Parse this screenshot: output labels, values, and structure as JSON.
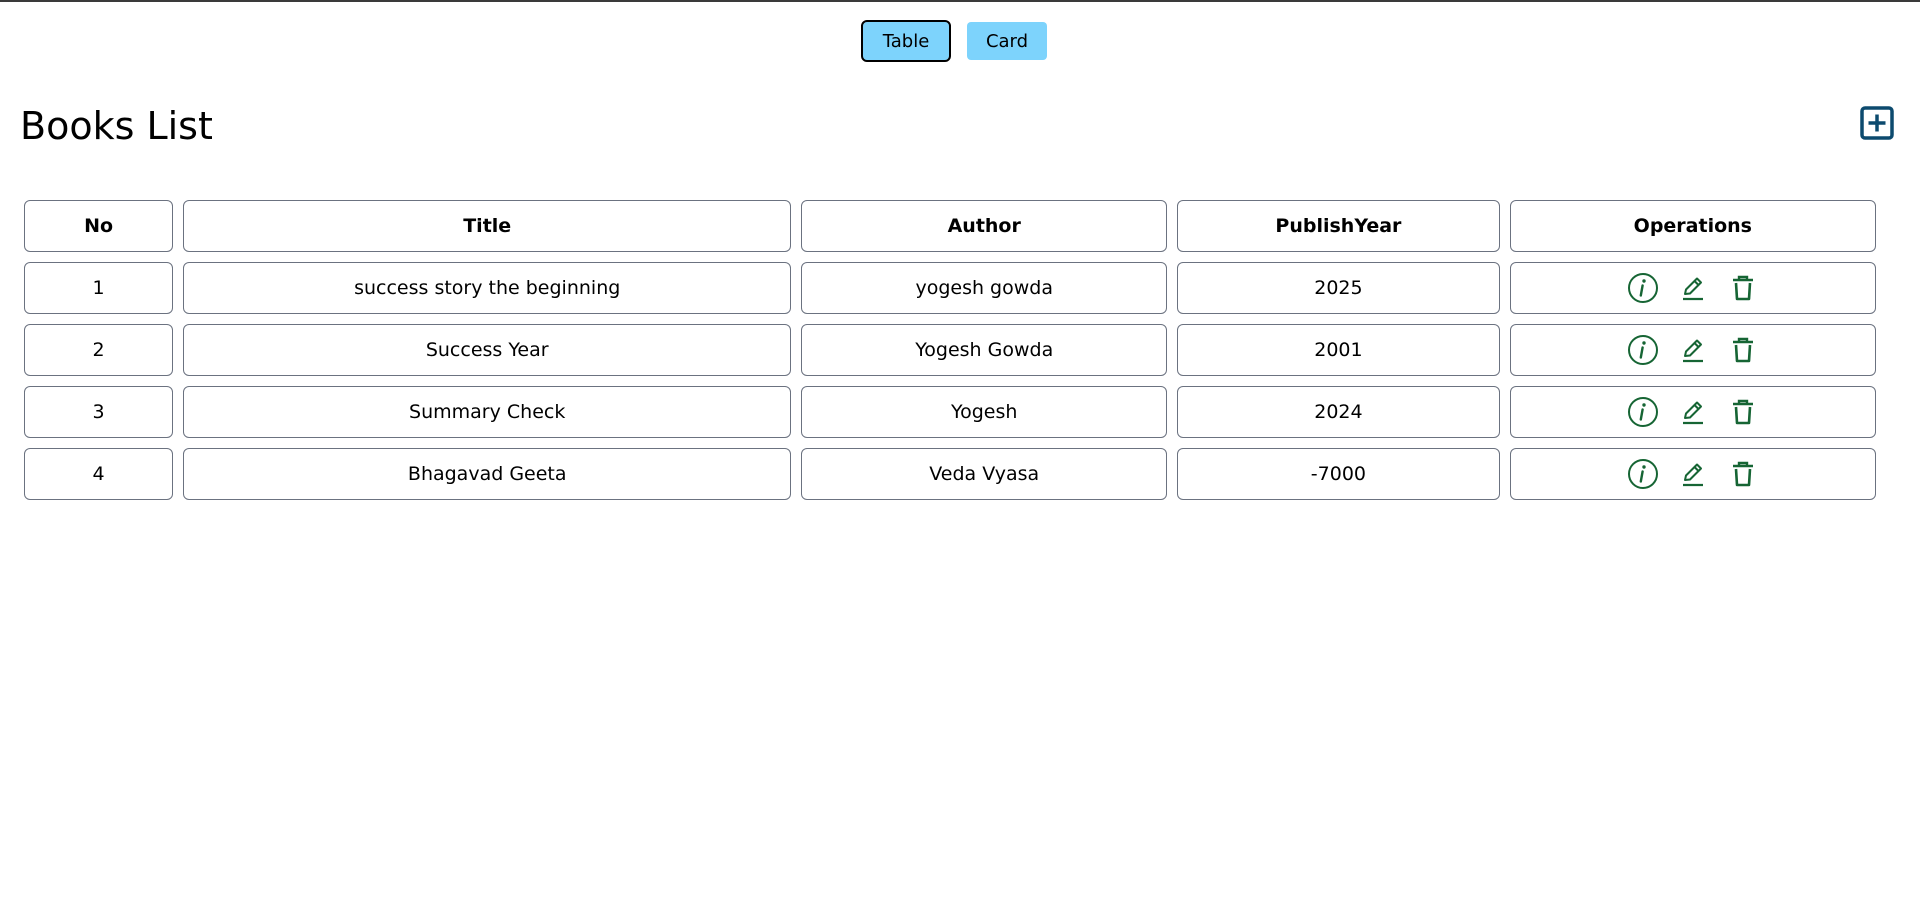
{
  "view_toggle": {
    "table_label": "Table",
    "card_label": "Card",
    "active": "Table"
  },
  "page": {
    "title": "Books List",
    "add_icon": "plus-square-icon"
  },
  "table": {
    "headers": [
      "No",
      "Title",
      "Author",
      "PublishYear",
      "Operations"
    ],
    "rows": [
      {
        "no": "1",
        "title": "success story the beginning",
        "author": "yogesh gowda",
        "year": "2025"
      },
      {
        "no": "2",
        "title": "Success Year",
        "author": "Yogesh Gowda",
        "year": "2001"
      },
      {
        "no": "3",
        "title": "Summary Check",
        "author": "Yogesh",
        "year": "2024"
      },
      {
        "no": "4",
        "title": "Bhagavad Geeta",
        "author": "Veda Vyasa",
        "year": "-7000"
      }
    ],
    "operation_icons": [
      "info-circle-icon",
      "edit-pencil-icon",
      "trash-icon"
    ]
  },
  "colors": {
    "toggle_bg": "#7dd3fc",
    "add_icon": "#0c4a6e",
    "op_icon": "#166534",
    "border": "#6b7280"
  }
}
